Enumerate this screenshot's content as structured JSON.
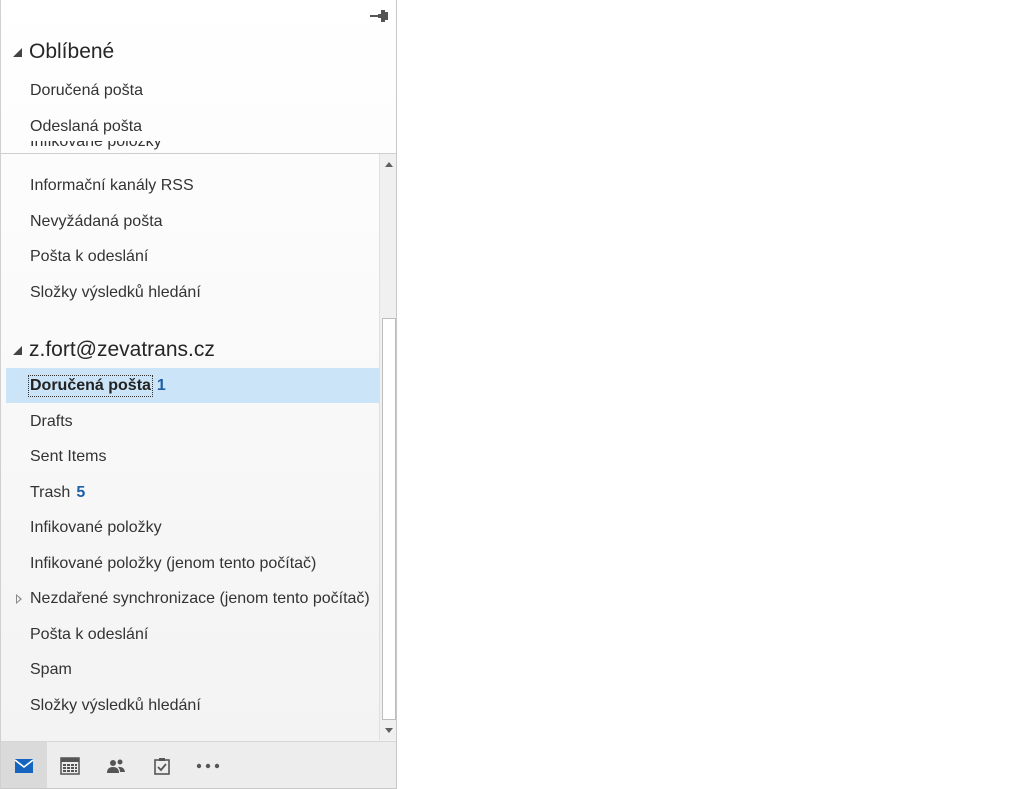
{
  "favorites": {
    "header": "Oblíbené",
    "items": [
      {
        "label": "Doručená pošta"
      },
      {
        "label": "Odeslaná pošta"
      }
    ]
  },
  "upper_list": {
    "partial_item": "Infikované položky",
    "items": [
      {
        "label": "Informační kanály RSS"
      },
      {
        "label": "Nevyžádaná pošta"
      },
      {
        "label": "Pošta k odeslání"
      },
      {
        "label": "Složky výsledků hledání"
      }
    ]
  },
  "account": {
    "header": "z.fort@zevatrans.cz",
    "items": [
      {
        "label": "Doručená pošta",
        "count": "1",
        "selected": true
      },
      {
        "label": "Drafts"
      },
      {
        "label": "Sent Items"
      },
      {
        "label": "Trash",
        "count": "5"
      },
      {
        "label": "Infikované položky"
      },
      {
        "label": "Infikované položky (jenom tento počítač)"
      },
      {
        "label": "Nezdařené synchronizace (jenom tento počítač)",
        "expandable": true
      },
      {
        "label": "Pošta k odeslání"
      },
      {
        "label": "Spam"
      },
      {
        "label": "Složky výsledků hledání"
      }
    ]
  },
  "bottom_nav": {
    "items": [
      {
        "icon": "mail-icon",
        "active": true
      },
      {
        "icon": "calendar-icon"
      },
      {
        "icon": "people-icon"
      },
      {
        "icon": "tasks-icon"
      },
      {
        "icon": "more-icon"
      }
    ]
  },
  "colors": {
    "selected_bg": "#cce4f7",
    "count": "#1e5fa8",
    "nav_active_icon": "#1565c0"
  }
}
